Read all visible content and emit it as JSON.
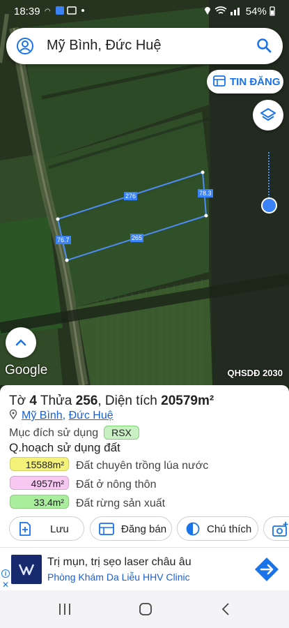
{
  "status_bar": {
    "time": "18:39",
    "left_icons": "wifi-call · shield · image · •",
    "right_icons": "location · wifi · signal",
    "battery": "54%"
  },
  "search": {
    "location_title": "Mỹ Bình, Đức Huệ"
  },
  "map": {
    "tin_dang_label": "TIN ĐĂNG",
    "google_logo": "Google",
    "overlay_label": "QHSDĐ 2030",
    "dimensions": {
      "top": "276",
      "right": "78.3",
      "bottom": "265",
      "left": "76.7"
    },
    "colors": {
      "boundary": "#4d8cf5",
      "accent": "#1a73e8"
    }
  },
  "parcel": {
    "sheet_prefix": "Tờ",
    "sheet_no": "4",
    "lot_prefix": "Thửa",
    "lot_no": "256",
    "area_prefix": ", Diện tích",
    "area_value": "20579m²",
    "ward": "Mỹ Bình",
    "separator": ",",
    "district": "Đức Huệ",
    "purpose_label": "Mục đích sử dụng",
    "purpose_code": "RSX",
    "plan_title": "Q.hoạch sử dụng đất",
    "plan_rows": [
      {
        "area": "15588m²",
        "desc": "Đất chuyên trồng lúa nước",
        "color": "#f5f27a"
      },
      {
        "area": "4957m²",
        "desc": "Đất ở nông thôn",
        "color": "#f6c8f2"
      },
      {
        "area": "33.4m²",
        "desc": "Đất rừng sản xuất",
        "color": "#a8ee9c"
      }
    ]
  },
  "actions": {
    "save": "Lưu",
    "sell": "Đăng bán",
    "legend": "Chú thích"
  },
  "ad": {
    "info_icon": "i",
    "close_icon": "✕",
    "headline": "Trị mụn, trị sẹo laser châu âu",
    "advertiser": "Phòng Khám Da Liễu HHV Clinic"
  }
}
